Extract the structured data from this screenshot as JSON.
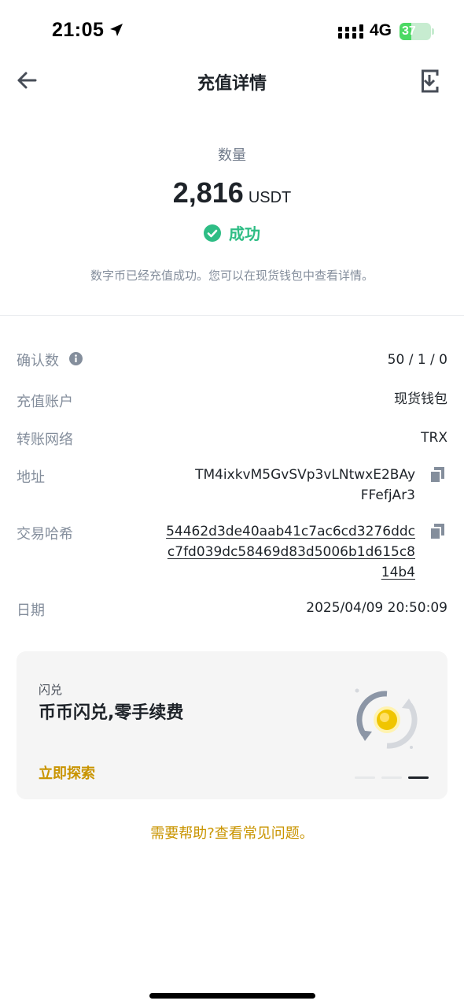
{
  "status_bar": {
    "time": "21:05",
    "network": "4G",
    "battery_level": "37",
    "battery_fraction": 0.37
  },
  "header": {
    "title": "充值详情",
    "back_icon": "arrow-left-icon",
    "share_icon": "share-download-icon"
  },
  "summary": {
    "quantity_label": "数量",
    "amount": "2,816",
    "unit": "USDT",
    "status": "成功",
    "status_color": "#2ebd85",
    "message": "数字币已经充值成功。您可以在现货钱包中查看详情。"
  },
  "details": {
    "confirmations": {
      "label": "确认数",
      "value": "50 / 1 / 0"
    },
    "account": {
      "label": "充值账户",
      "value": "现货钱包"
    },
    "network": {
      "label": "转账网络",
      "value": "TRX"
    },
    "address": {
      "label": "地址",
      "line1": "TM4ixkvM5GvSVp3vLNtwxE2BAy",
      "line2": "FFefjAr3"
    },
    "txid": {
      "label": "交易哈希",
      "line1": "54462d3de40aab41c7ac6cd3276ddc",
      "line2": "c7fd039dc58469d83d5006b1d615c8",
      "line3": "14b4"
    },
    "date": {
      "label": "日期",
      "value": "2025/04/09 20:50:09"
    }
  },
  "promo": {
    "tag": "闪兑",
    "title": "币币闪兑,零手续费",
    "link": "立即探索",
    "icon": "convert-coin-icon",
    "page_count": 3,
    "active_page": 3
  },
  "help": {
    "text": "需要帮助?查看常见问题。"
  },
  "colors": {
    "accent": "#c99400",
    "success": "#2ebd85",
    "label": "#848e9c",
    "text": "#1e2329"
  }
}
